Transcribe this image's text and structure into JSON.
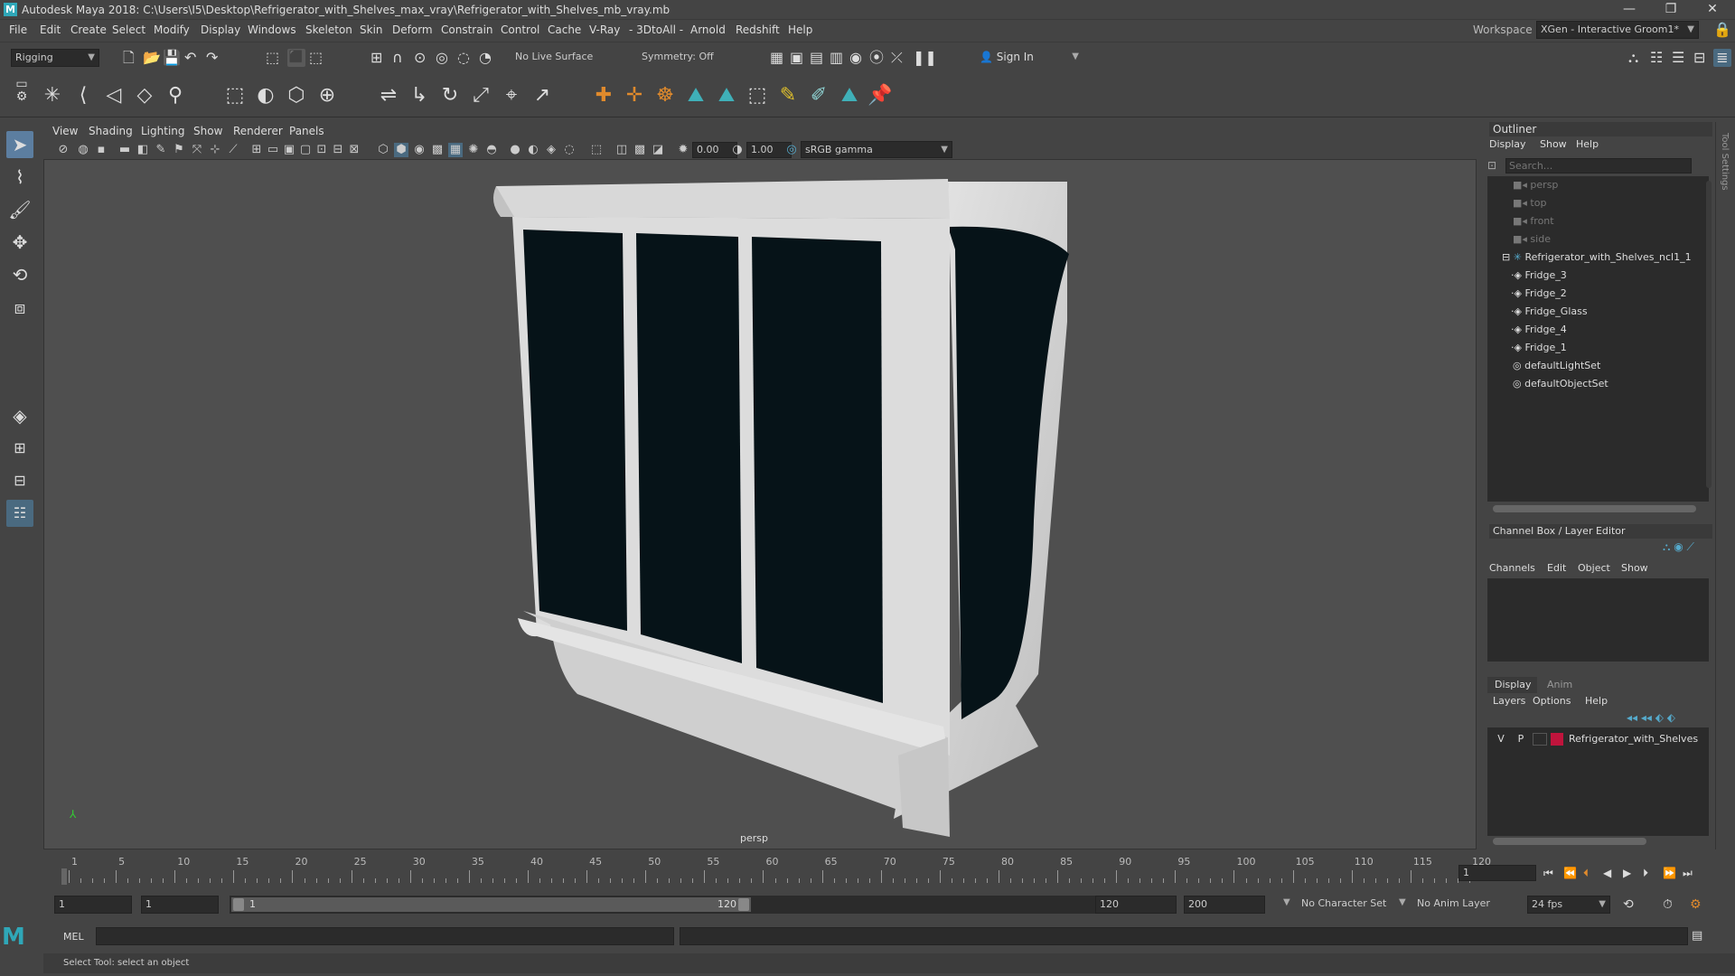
{
  "window": {
    "title": "Autodesk Maya 2018: C:\\Users\\I5\\Desktop\\Refrigerator_with_Shelves_max_vray\\Refrigerator_with_Shelves_mb_vray.mb",
    "logo_letter": "M"
  },
  "menus": [
    "File",
    "Edit",
    "Create",
    "Select",
    "Modify",
    "Display",
    "Windows",
    "Skeleton",
    "Skin",
    "Deform",
    "Constrain",
    "Control",
    "Cache",
    "V-Ray",
    "- 3DtoAll -",
    "Arnold",
    "Redshift",
    "Help"
  ],
  "workspace": {
    "label": "Workspace :",
    "value": "XGen - Interactive Groom1*"
  },
  "statusline": {
    "mode": "Rigging",
    "live_surface": "No Live Surface",
    "symmetry": "Symmetry: Off",
    "sign_in": "Sign In"
  },
  "viewport": {
    "menus": [
      "View",
      "Shading",
      "Lighting",
      "Show",
      "Renderer",
      "Panels"
    ],
    "exposure": "0.00",
    "gamma": "1.00",
    "color_space": "sRGB gamma",
    "camera_label": "persp"
  },
  "outliner": {
    "title": "Outliner",
    "menus": [
      "Display",
      "Show",
      "Help"
    ],
    "search_placeholder": "Search...",
    "items": [
      {
        "label": "persp",
        "dim": true,
        "indent": 0,
        "icon": "camera-icon"
      },
      {
        "label": "top",
        "dim": true,
        "indent": 0,
        "icon": "camera-icon"
      },
      {
        "label": "front",
        "dim": true,
        "indent": 0,
        "icon": "camera-icon"
      },
      {
        "label": "side",
        "dim": true,
        "indent": 0,
        "icon": "camera-icon"
      },
      {
        "label": "Refrigerator_with_Shelves_ncl1_1",
        "dim": false,
        "indent": 0,
        "icon": "group-icon"
      },
      {
        "label": "Fridge_3",
        "dim": false,
        "indent": 1,
        "icon": "mesh-icon"
      },
      {
        "label": "Fridge_2",
        "dim": false,
        "indent": 1,
        "icon": "mesh-icon"
      },
      {
        "label": "Fridge_Glass",
        "dim": false,
        "indent": 1,
        "icon": "mesh-icon"
      },
      {
        "label": "Fridge_4",
        "dim": false,
        "indent": 1,
        "icon": "mesh-icon"
      },
      {
        "label": "Fridge_1",
        "dim": false,
        "indent": 1,
        "icon": "mesh-icon"
      },
      {
        "label": "defaultLightSet",
        "dim": false,
        "indent": 0,
        "icon": "set-icon"
      },
      {
        "label": "defaultObjectSet",
        "dim": false,
        "indent": 0,
        "icon": "set-icon"
      }
    ]
  },
  "channelbox": {
    "title": "Channel Box / Layer Editor",
    "menus": [
      "Channels",
      "Edit",
      "Object",
      "Show"
    ]
  },
  "layereditor": {
    "tabs": [
      "Display",
      "Anim"
    ],
    "menus": [
      "Layers",
      "Options",
      "Help"
    ],
    "layer": {
      "v": "V",
      "p": "P",
      "name": "Refrigerator_with_Shelves",
      "color": "#c0143c"
    }
  },
  "timeline": {
    "ticks": [
      "1",
      "5",
      "10",
      "15",
      "20",
      "25",
      "30",
      "35",
      "40",
      "45",
      "50",
      "55",
      "60",
      "65",
      "70",
      "75",
      "80",
      "85",
      "90",
      "95",
      "100",
      "105",
      "110",
      "115",
      "120"
    ],
    "current_frame": "1"
  },
  "range": {
    "start": "1",
    "playback_start": "1",
    "slider_start": "1",
    "slider_end": "120",
    "playback_end": "120",
    "end": "200",
    "character_set": "No Character Set",
    "anim_layer": "No Anim Layer",
    "fps": "24 fps"
  },
  "cmdline": {
    "label": "MEL"
  },
  "helpline": {
    "text": "Select Tool: select an object"
  },
  "side_tab": {
    "label": "Tool Settings"
  }
}
